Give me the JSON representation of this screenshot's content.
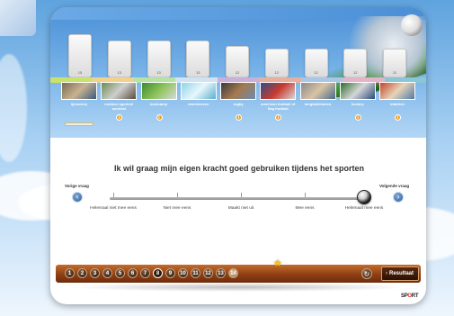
{
  "bars": [
    {
      "value": "15",
      "level": 0.83
    },
    {
      "value": "13",
      "level": 0.7
    },
    {
      "value": "13",
      "level": 0.7
    },
    {
      "value": "13",
      "level": 0.7
    },
    {
      "value": "12",
      "level": 0.6
    },
    {
      "value": "12",
      "level": 0.55
    },
    {
      "value": "12",
      "level": 0.55
    },
    {
      "value": "12",
      "level": 0.55
    },
    {
      "value": "11",
      "level": 0.55
    }
  ],
  "band_colors": [
    "#c9e26a",
    "#f0d28a",
    "#b6e3a4",
    "#cfe3f2",
    "#cab0d9",
    "#e7b09e",
    "#a8c7e8",
    "#e5b3c9",
    "#8ac7d6"
  ],
  "sports": [
    {
      "label": "ijshockey",
      "info": false
    },
    {
      "label": "outdoor sporten/ survival",
      "info": true
    },
    {
      "label": "bootcamp",
      "info": true
    },
    {
      "label": "zwemlessen",
      "info": false
    },
    {
      "label": "rugby",
      "info": true
    },
    {
      "label": "american football of flag football",
      "info": true
    },
    {
      "label": "bergbeklimmen",
      "info": false
    },
    {
      "label": "hockey",
      "info": true
    },
    {
      "label": "triathlon",
      "info": true
    }
  ],
  "info_symbol": "i",
  "question": "Ik wil graag mijn eigen kracht goed gebruiken tijdens het sporten",
  "nav": {
    "prev_label": "Vorige vraag",
    "next_label": "Volgende vraag",
    "prev_arrow": "‹",
    "next_arrow": "›"
  },
  "scale": {
    "labels": [
      "Helemaal niet mee eens",
      "Niet mee eens",
      "Maakt niet uit",
      "Mee eens",
      "Helemaal mee eens"
    ],
    "selected_index": 4
  },
  "pages": {
    "numbers": [
      "1",
      "2",
      "3",
      "4",
      "5",
      "6",
      "7",
      "8",
      "9",
      "10",
      "11",
      "12",
      "13",
      "14"
    ],
    "current": 8,
    "star_symbol": "★"
  },
  "refresh_symbol": "↻",
  "result_button": {
    "arrow": "›",
    "label": "Resultaat"
  },
  "logo": {
    "part1": "SP",
    "part2": "O",
    "part3": "RT"
  }
}
